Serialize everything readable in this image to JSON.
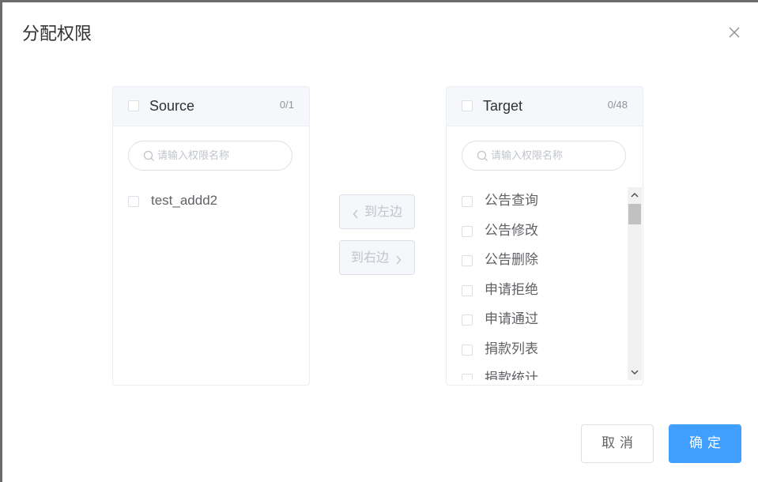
{
  "dialog": {
    "title": "分配权限"
  },
  "source_panel": {
    "title": "Source",
    "count": "0/1",
    "search_placeholder": "请输入权限名称",
    "items": [
      "test_addd2"
    ]
  },
  "target_panel": {
    "title": "Target",
    "count": "0/48",
    "search_placeholder": "请输入权限名称",
    "items": [
      "公告查询",
      "公告修改",
      "公告删除",
      "申请拒绝",
      "申请通过",
      "捐款列表",
      "捐款统计"
    ]
  },
  "transfer": {
    "to_left_label": "到左边",
    "to_right_label": "到右边"
  },
  "footer": {
    "cancel_label": "取消",
    "confirm_label": "确定"
  },
  "colors": {
    "primary": "#409eff",
    "header_bg": "#f5f7fa",
    "border": "#dcdfe6"
  }
}
